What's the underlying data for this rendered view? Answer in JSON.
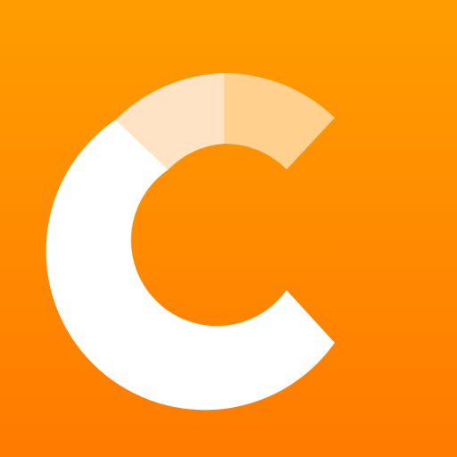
{
  "app_icon": {
    "name": "C logo app icon",
    "icon": "letter-c-segmented-ring-icon",
    "colors": {
      "background_top": "#ff9d00",
      "background_bottom": "#ff7a00",
      "ring_main": "#ffffff",
      "ring_segment_1": "#ffe3c4",
      "ring_segment_2": "#ffd08e"
    }
  }
}
